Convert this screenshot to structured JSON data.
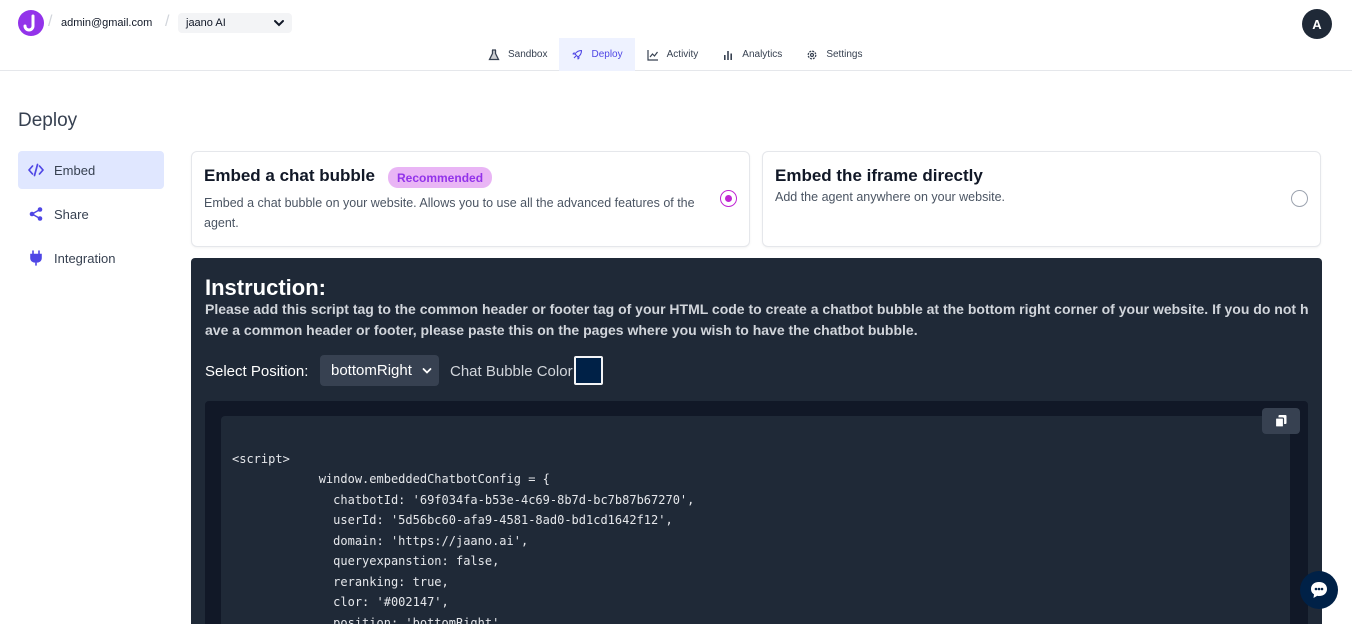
{
  "header": {
    "logo_letter": "J",
    "email": "admin@gmail.com",
    "agent_name": "jaano AI",
    "avatar_letter": "A"
  },
  "tabs": [
    {
      "label": "Sandbox",
      "icon": "flask-icon",
      "active": false
    },
    {
      "label": "Deploy",
      "icon": "rocket-icon",
      "active": true
    },
    {
      "label": "Activity",
      "icon": "activity-chart-icon",
      "active": false
    },
    {
      "label": "Analytics",
      "icon": "bar-chart-icon",
      "active": false
    },
    {
      "label": "Settings",
      "icon": "gear-icon",
      "active": false
    }
  ],
  "page_title": "Deploy",
  "sidebar": {
    "items": [
      {
        "label": "Embed",
        "icon": "code-icon",
        "active": true
      },
      {
        "label": "Share",
        "icon": "share-icon",
        "active": false
      },
      {
        "label": "Integration",
        "icon": "plug-icon",
        "active": false
      }
    ]
  },
  "options": {
    "bubble": {
      "title": "Embed a chat bubble",
      "badge": "Recommended",
      "description": "Embed a chat bubble on your website. Allows you to use all the advanced features of the agent.",
      "selected": true
    },
    "iframe": {
      "title": "Embed the iframe directly",
      "description": "Add the agent anywhere on your website.",
      "selected": false
    }
  },
  "instruction": {
    "title": "Instruction:",
    "text": "Please add this script tag to the common header or footer tag of your HTML code to create a chatbot bubble at the bottom right corner of your website. If you do not have a common header or footer, please paste this on the pages where you wish to have the chatbot bubble.",
    "position_label": "Select Position:",
    "position_value": "bottomRight",
    "color_label": "Chat Bubble Color",
    "bubble_color": "#002147"
  },
  "code_lines": [
    "<script>",
    "            window.embeddedChatbotConfig = {",
    "              chatbotId: '69f034fa-b53e-4c69-8b7d-bc7b87b67270',",
    "              userId: '5d56bc60-afa9-4581-8ad0-bd1cd1642f12',",
    "              domain: 'https://jaano.ai',",
    "              queryexpanstion: false,",
    "              reranking: true,",
    "              clor: '#002147',",
    "              position: 'bottomRight'",
    "            };"
  ],
  "colors": {
    "accent": "#4f46e5",
    "brand": "#9333ea",
    "radio_selected": "#c026d3",
    "panel_bg": "#1f2937"
  }
}
